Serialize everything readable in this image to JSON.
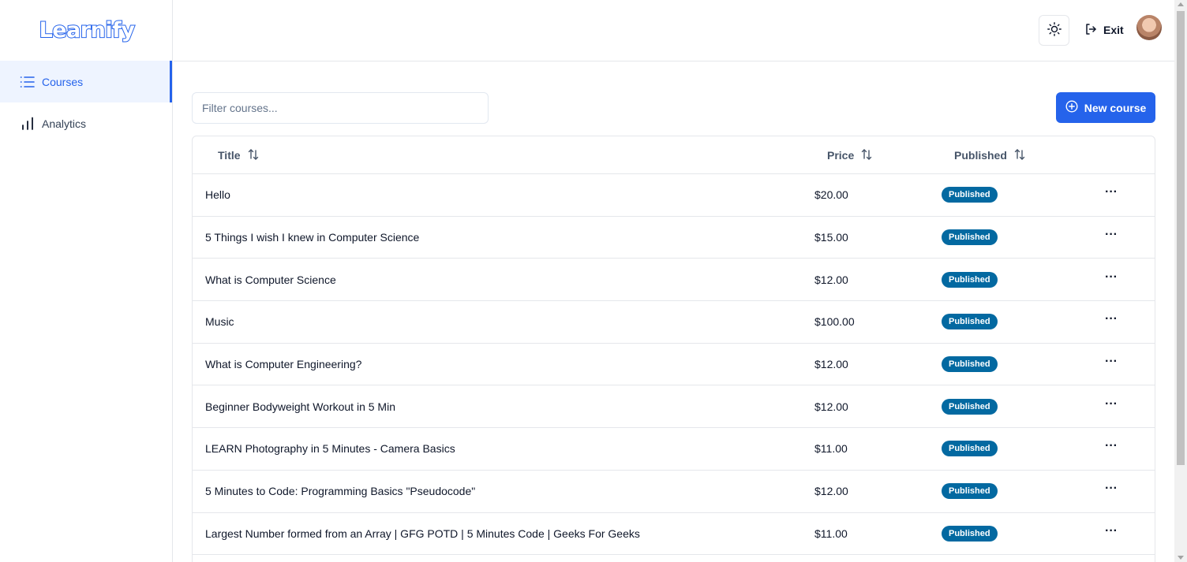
{
  "app": {
    "logo": "Learnify"
  },
  "sidebar": {
    "items": [
      {
        "label": "Courses",
        "icon": "list-icon",
        "active": true
      },
      {
        "label": "Analytics",
        "icon": "bar-chart-icon",
        "active": false
      }
    ]
  },
  "header": {
    "theme_icon": "sun-icon",
    "exit_label": "Exit",
    "exit_icon": "logout-icon",
    "avatar": "user-avatar"
  },
  "toolbar": {
    "filter_placeholder": "Filter courses...",
    "new_course_label": "New course",
    "new_course_icon": "plus-circle-icon"
  },
  "table": {
    "columns": [
      "Title",
      "Price",
      "Published"
    ],
    "rows": [
      {
        "title": "Hello",
        "price": "$20.00",
        "status": "Published"
      },
      {
        "title": "5 Things I wish I knew in Computer Science",
        "price": "$15.00",
        "status": "Published"
      },
      {
        "title": "What is Computer Science",
        "price": "$12.00",
        "status": "Published"
      },
      {
        "title": "Music",
        "price": "$100.00",
        "status": "Published"
      },
      {
        "title": "What is Computer Engineering?",
        "price": "$12.00",
        "status": "Published"
      },
      {
        "title": "Beginner Bodyweight Workout in 5 Min",
        "price": "$12.00",
        "status": "Published"
      },
      {
        "title": "LEARN Photography in 5 Minutes - Camera Basics",
        "price": "$11.00",
        "status": "Published"
      },
      {
        "title": "5 Minutes to Code: Programming Basics \"Pseudocode\"",
        "price": "$12.00",
        "status": "Published"
      },
      {
        "title": "Largest Number formed from an Array | GFG POTD | 5 Minutes Code | Geeks For Geeks",
        "price": "$11.00",
        "status": "Published"
      }
    ],
    "actions_label": "···"
  },
  "colors": {
    "accent": "#2563eb",
    "badge": "#0369a1",
    "active_bg": "#eef4ff"
  }
}
